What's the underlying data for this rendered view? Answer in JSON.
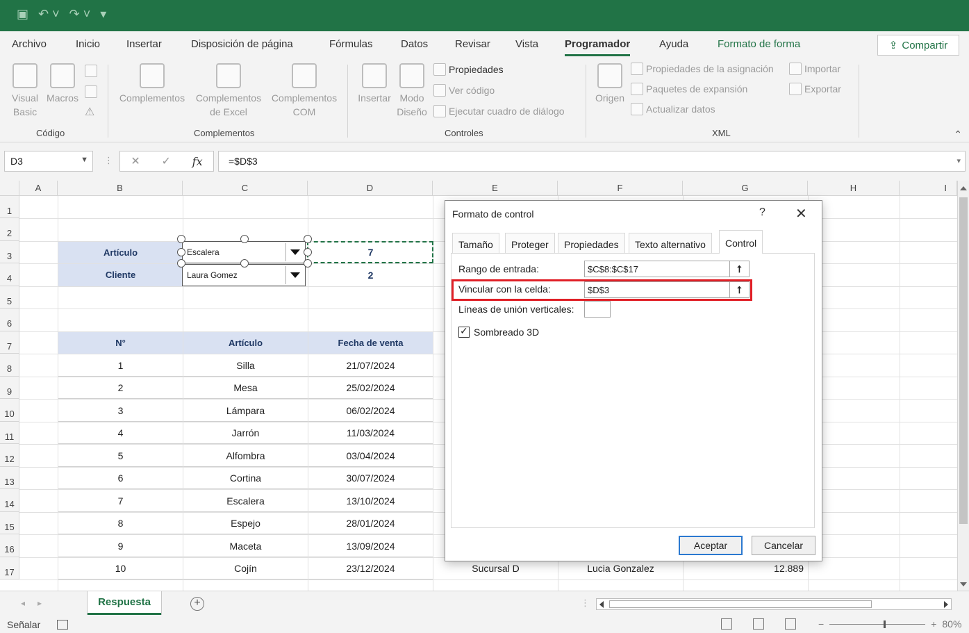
{
  "ribbon_tabs": [
    "Archivo",
    "Inicio",
    "Insertar",
    "Disposición de página",
    "Fórmulas",
    "Datos",
    "Revisar",
    "Vista",
    "Programador",
    "Ayuda",
    "Formato de forma"
  ],
  "share_label": "Compartir",
  "ribbon": {
    "codigo": {
      "label": "Código",
      "visual_basic": "Visual Basic",
      "macros": "Macros"
    },
    "complementos": {
      "label": "Complementos",
      "complementos": "Complementos",
      "excel": "Complementos de Excel",
      "com": "Complementos COM"
    },
    "controles": {
      "label": "Controles",
      "insertar": "Insertar",
      "modo_diseno": "Modo Diseño",
      "propiedades": "Propiedades",
      "ver_codigo": "Ver código",
      "ejecutar": "Ejecutar cuadro de diálogo"
    },
    "xml": {
      "label": "XML",
      "origen": "Origen",
      "prop_asignacion": "Propiedades de la asignación",
      "paquetes": "Paquetes de expansión",
      "actualizar": "Actualizar datos",
      "importar": "Importar",
      "exportar": "Exportar"
    }
  },
  "namebox": "D3",
  "formula": "=$D$3",
  "columns": [
    "A",
    "B",
    "C",
    "D",
    "E",
    "F",
    "G",
    "H",
    "I"
  ],
  "rows": [
    "1",
    "2",
    "3",
    "4",
    "5",
    "6",
    "7",
    "8",
    "9",
    "10",
    "11",
    "12",
    "13",
    "14",
    "15",
    "16",
    "17"
  ],
  "lookup": {
    "articulo_label": "Artículo",
    "cliente_label": "Cliente",
    "combo_articulo": "Escalera",
    "combo_cliente": "Laura Gomez",
    "d3": "7",
    "d4": "2"
  },
  "table_headers": [
    "N°",
    "Artículo",
    "Fecha de venta"
  ],
  "table_rows": [
    [
      "1",
      "Silla",
      "21/07/2024"
    ],
    [
      "2",
      "Mesa",
      "25/02/2024"
    ],
    [
      "3",
      "Lámpara",
      "06/02/2024"
    ],
    [
      "4",
      "Jarrón",
      "11/03/2024"
    ],
    [
      "5",
      "Alfombra",
      "03/04/2024"
    ],
    [
      "6",
      "Cortina",
      "30/07/2024"
    ],
    [
      "7",
      "Escalera",
      "13/10/2024"
    ],
    [
      "8",
      "Espejo",
      "28/01/2024"
    ],
    [
      "9",
      "Maceta",
      "13/09/2024"
    ],
    [
      "10",
      "Cojín",
      "23/12/2024"
    ]
  ],
  "row17_extra": {
    "e": "Sucursal D",
    "f": "Lucia Gonzalez",
    "g": "12.889"
  },
  "sheet_tab": "Respuesta",
  "status": {
    "mode": "Señalar",
    "zoom": "80%"
  },
  "dialog": {
    "title": "Formato de control",
    "help": "?",
    "tabs": [
      "Tamaño",
      "Proteger",
      "Propiedades",
      "Texto alternativo",
      "Control"
    ],
    "active_tab": "Control",
    "rango_label": "Rango de entrada:",
    "rango_value": "$C$8:$C$17",
    "vincular_label": "Vincular con la celda:",
    "vincular_value": "$D$3",
    "lineas_label": "Líneas de unión verticales:",
    "lineas_value": "",
    "sombreado_label": "Sombreado 3D",
    "sombreado_checked": true,
    "ok": "Aceptar",
    "cancel": "Cancelar"
  }
}
